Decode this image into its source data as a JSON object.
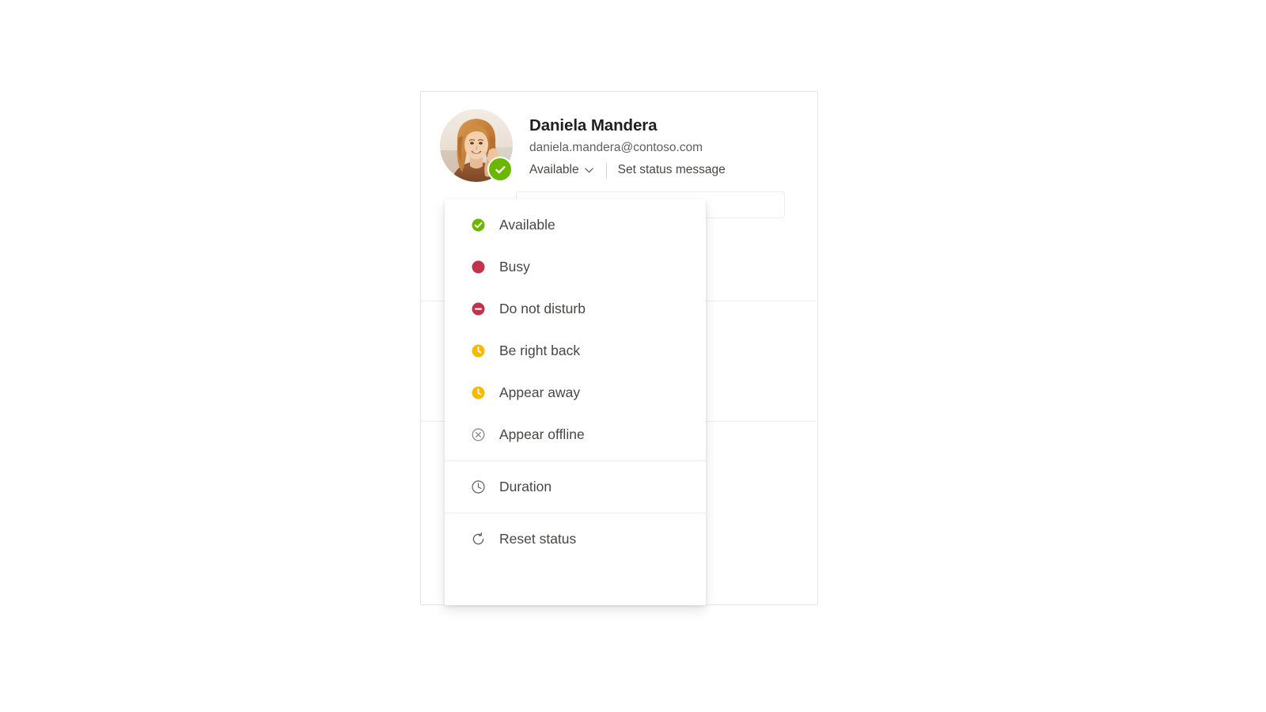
{
  "profile": {
    "name": "Daniela Mandera",
    "email": "daniela.mandera@contoso.com",
    "current_status": "Available",
    "current_status_color": "#6bb700",
    "set_status_message_label": "Set status message",
    "avatar_badge_icon": "available-check-icon",
    "chevron_icon": "chevron-down-icon"
  },
  "status_menu": {
    "presence_options": [
      {
        "label": "Available",
        "icon": "presence-available-icon",
        "color": "#6bb700"
      },
      {
        "label": "Busy",
        "icon": "presence-busy-icon",
        "color": "#c4314b"
      },
      {
        "label": "Do not disturb",
        "icon": "presence-dnd-icon",
        "color": "#c4314b"
      },
      {
        "label": "Be right back",
        "icon": "presence-brb-icon",
        "color": "#f8b900"
      },
      {
        "label": "Appear away",
        "icon": "presence-away-icon",
        "color": "#f8b900"
      },
      {
        "label": "Appear offline",
        "icon": "presence-offline-icon",
        "color": "#8a8886"
      }
    ],
    "duration": {
      "label": "Duration",
      "icon": "clock-icon",
      "color": "#605e5c"
    },
    "reset": {
      "label": "Reset status",
      "icon": "reset-refresh-icon",
      "color": "#605e5c"
    }
  },
  "colors": {
    "card_border": "#e6e6e6",
    "divider": "#ededed",
    "menu_text": "#484644",
    "name_text": "#201f1e",
    "email_text": "#605e5c"
  }
}
